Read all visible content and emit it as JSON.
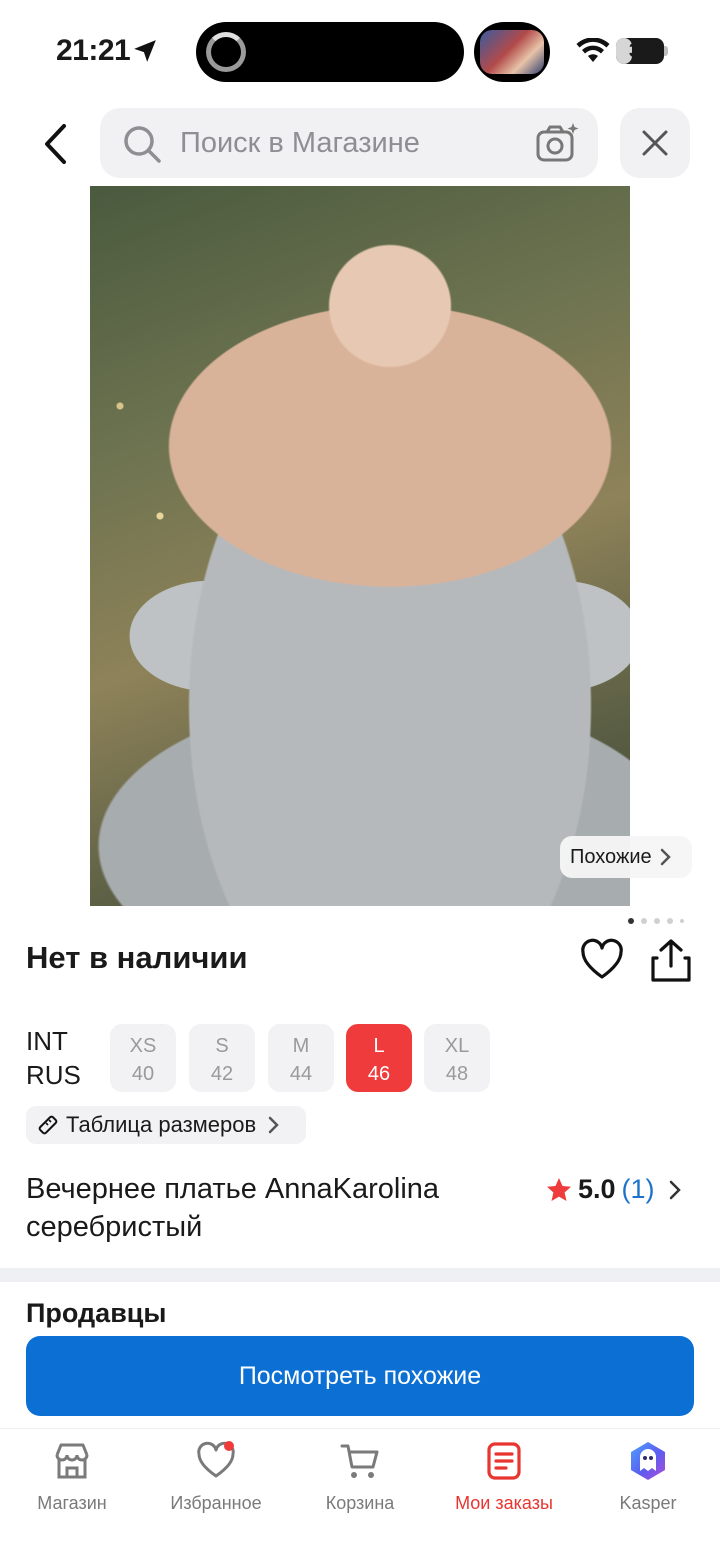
{
  "status_bar": {
    "time": "21:21",
    "battery": "33"
  },
  "search": {
    "placeholder": "Поиск в Магазине"
  },
  "photo": {
    "similar_chip": "Похожие"
  },
  "product": {
    "availability": "Нет в наличии",
    "size_system": {
      "int": "INT",
      "rus": "RUS"
    },
    "sizes": [
      {
        "int": "XS",
        "rus": "40",
        "selected": false
      },
      {
        "int": "S",
        "rus": "42",
        "selected": false
      },
      {
        "int": "M",
        "rus": "44",
        "selected": false
      },
      {
        "int": "L",
        "rus": "46",
        "selected": true
      },
      {
        "int": "XL",
        "rus": "48",
        "selected": false
      }
    ],
    "size_table_label": "Таблица размеров",
    "title": "Вечернее платье AnnaKarolina серебристый",
    "rating": "5.0",
    "reviews": "(1)"
  },
  "sellers_heading": "Продавцы",
  "cta": {
    "label": "Посмотреть похожие"
  },
  "tabbar": {
    "items": [
      {
        "label": "Магазин",
        "icon": "store-icon"
      },
      {
        "label": "Избранное",
        "icon": "heart-icon"
      },
      {
        "label": "Корзина",
        "icon": "cart-icon"
      },
      {
        "label": "Мои заказы",
        "icon": "orders-icon",
        "active": true
      },
      {
        "label": "Kasper",
        "icon": "kasper-icon"
      }
    ]
  },
  "colors": {
    "accent_red": "#ef3b3b",
    "primary_blue": "#0b6fd3",
    "active_tab": "#e8352f",
    "link_blue": "#1d73c9"
  }
}
